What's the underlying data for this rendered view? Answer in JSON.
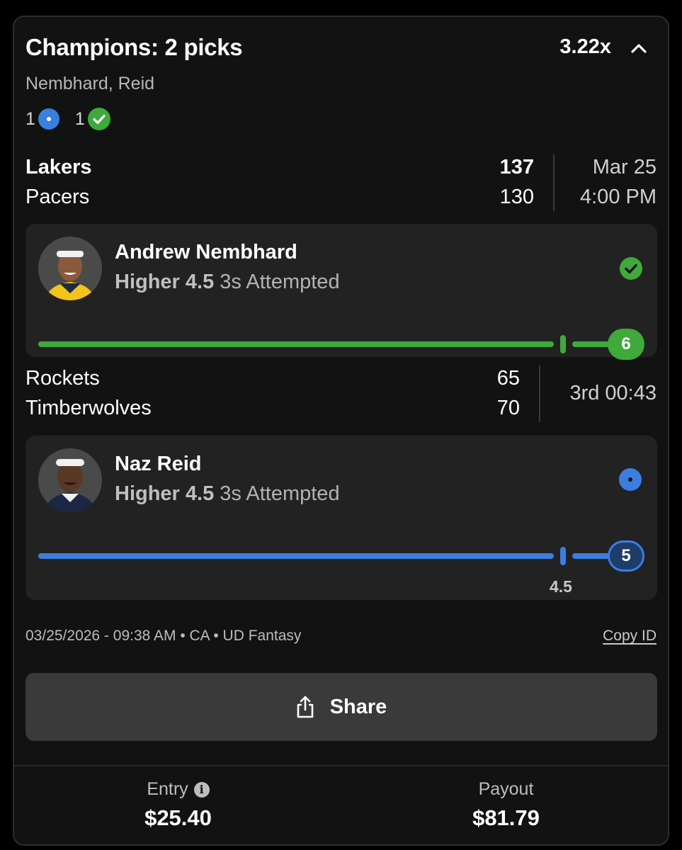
{
  "header": {
    "title": "Champions: 2 picks",
    "multiplier": "3.22x",
    "players": "Nembhard, Reid",
    "pending_count": "1",
    "won_count": "1"
  },
  "games": [
    {
      "team1": "Lakers",
      "score1": "137",
      "team2": "Pacers",
      "score2": "130",
      "date": "Mar 25",
      "time": "4:00 PM"
    },
    {
      "team1": "Rockets",
      "score1": "65",
      "team2": "Timberwolves",
      "score2": "70",
      "status": "3rd 00:43"
    }
  ],
  "picks": [
    {
      "player": "Andrew Nembhard",
      "direction": "Higher",
      "line": "4.5",
      "stat": "3s Attempted",
      "current": "6",
      "status": "won",
      "progress": 1.0,
      "color": "#3fa93b"
    },
    {
      "player": "Naz Reid",
      "direction": "Higher",
      "line": "4.5",
      "stat": "3s Attempted",
      "current": "5",
      "status": "pending",
      "progress": 1.0,
      "line_label": "4.5",
      "color": "#3a7fe0"
    }
  ],
  "meta": {
    "timestamp": "03/25/2026 - 09:38 AM • CA • UD Fantasy",
    "copy_id": "Copy ID"
  },
  "share_label": "Share",
  "footer": {
    "entry_label": "Entry",
    "entry_value": "$25.40",
    "payout_label": "Payout",
    "payout_value": "$81.79"
  },
  "icons": [
    "chevron-up-icon",
    "pending-dot-icon",
    "check-circle-icon",
    "share-icon",
    "info-icon"
  ]
}
